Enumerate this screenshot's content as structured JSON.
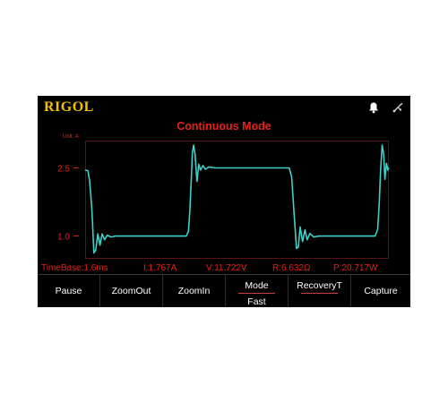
{
  "device": {
    "brand_logo": "RIGOL",
    "screen_title": "Continuous Mode",
    "status_icons": [
      "bell-icon",
      "usb-icon"
    ]
  },
  "chart_data": {
    "type": "line",
    "ylabel": "Unit: A",
    "yticks": [
      {
        "value": 2.5,
        "label": "2.5"
      },
      {
        "value": 1.0,
        "label": "1.0"
      }
    ],
    "ylim": [
      0.5,
      3.1
    ],
    "xlim": [
      0,
      10
    ],
    "grid": false,
    "series": [
      {
        "color": "#3fd0c8",
        "points": [
          [
            0.0,
            2.45
          ],
          [
            0.09,
            2.44
          ],
          [
            0.15,
            2.2
          ],
          [
            0.22,
            1.6
          ],
          [
            0.29,
            0.63
          ],
          [
            0.35,
            0.7
          ],
          [
            0.42,
            1.05
          ],
          [
            0.49,
            0.8
          ],
          [
            0.56,
            1.05
          ],
          [
            0.64,
            0.92
          ],
          [
            0.73,
            1.02
          ],
          [
            0.85,
            0.98
          ],
          [
            1.0,
            1.0
          ],
          [
            2.0,
            1.0
          ],
          [
            3.0,
            1.0
          ],
          [
            3.33,
            1.0
          ],
          [
            3.4,
            1.1
          ],
          [
            3.45,
            1.6
          ],
          [
            3.5,
            2.3
          ],
          [
            3.53,
            2.83
          ],
          [
            3.57,
            3.0
          ],
          [
            3.62,
            2.8
          ],
          [
            3.68,
            2.2
          ],
          [
            3.74,
            2.58
          ],
          [
            3.8,
            2.45
          ],
          [
            3.88,
            2.55
          ],
          [
            3.96,
            2.47
          ],
          [
            4.08,
            2.52
          ],
          [
            4.3,
            2.5
          ],
          [
            5.5,
            2.5
          ],
          [
            6.6,
            2.5
          ],
          [
            6.72,
            2.5
          ],
          [
            6.8,
            2.3
          ],
          [
            6.88,
            1.5
          ],
          [
            6.96,
            0.73
          ],
          [
            7.02,
            0.76
          ],
          [
            7.08,
            1.2
          ],
          [
            7.16,
            0.88
          ],
          [
            7.24,
            1.14
          ],
          [
            7.31,
            0.92
          ],
          [
            7.4,
            1.06
          ],
          [
            7.52,
            0.98
          ],
          [
            7.7,
            1.0
          ],
          [
            8.5,
            1.0
          ],
          [
            9.3,
            1.0
          ],
          [
            9.55,
            1.0
          ],
          [
            9.63,
            1.15
          ],
          [
            9.68,
            1.7
          ],
          [
            9.73,
            2.45
          ],
          [
            9.78,
            3.0
          ],
          [
            9.83,
            2.8
          ],
          [
            9.87,
            2.25
          ],
          [
            9.92,
            2.6
          ],
          [
            9.97,
            2.45
          ],
          [
            10.0,
            2.5
          ]
        ]
      }
    ]
  },
  "readouts": {
    "timebase": "TimeBase:1.6ms",
    "current": "I:1.767A",
    "voltage": "V:11.722V",
    "resistance": "R:6.632Ω",
    "power": "P:20.717W"
  },
  "softkeys": {
    "pause": "Pause",
    "zoom_out": "ZoomOut",
    "zoom_in": "ZoomIn",
    "mode_label": "Mode",
    "mode_value": "Fast",
    "recovery": "RecoveryT",
    "capture": "Capture"
  }
}
